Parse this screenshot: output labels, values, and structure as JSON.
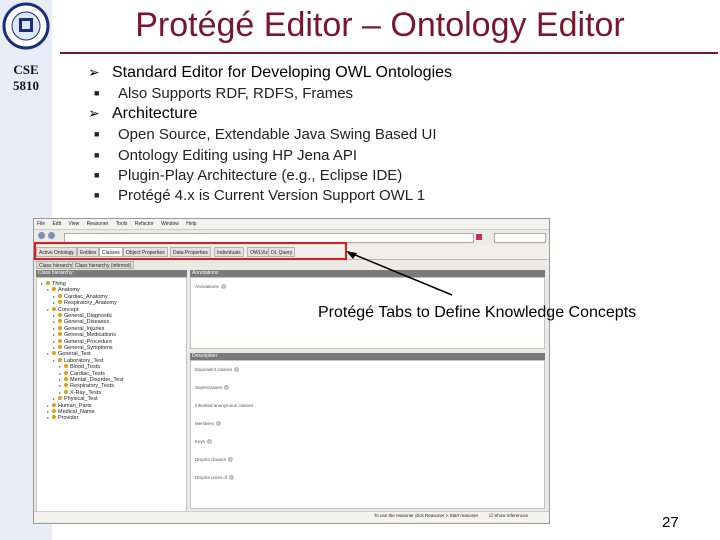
{
  "slide": {
    "title": "Protégé Editor – Ontology Editor",
    "course": "CSE\n5810",
    "page_number": "27",
    "callout": "Protégé Tabs to Define Knowledge Concepts",
    "colors": {
      "title": "#7a1530",
      "sidebar": "#e9edf8",
      "highlight_box": "#e41a1a"
    }
  },
  "bullets": [
    {
      "text": "Standard Editor for Developing OWL Ontologies",
      "sub": [
        "Also Supports RDF, RDFS, Frames"
      ]
    },
    {
      "text": "Architecture",
      "sub": [
        "Open Source, Extendable Java Swing Based UI",
        "Ontology Editing using HP Jena API",
        "Plugin-Play Architecture (e.g., Eclipse IDE)",
        "Protégé 4.x is Current Version Support OWL 1"
      ]
    }
  ],
  "app": {
    "menu": [
      "File",
      "Edit",
      "View",
      "Reasoner",
      "Tools",
      "Refactor",
      "Window",
      "Help"
    ],
    "tabs": [
      "Active Ontology",
      "Entities",
      "Classes",
      "Object Properties",
      "Data Properties",
      "Individuals",
      "OWLViz",
      "DL Query"
    ],
    "active_tab": "Classes",
    "subtabs": [
      "Class hierarchy",
      "Class hierarchy (inferred)"
    ],
    "left_header": "Class hierarchy:",
    "tree": [
      {
        "label": "Thing",
        "level": 0
      },
      {
        "label": "Anatomy",
        "level": 1
      },
      {
        "label": "Cardiac_Anatomy",
        "level": 2
      },
      {
        "label": "Respiratory_Anatomy",
        "level": 2
      },
      {
        "label": "Concept",
        "level": 1
      },
      {
        "label": "General_Diagnostic",
        "level": 2
      },
      {
        "label": "General_Diseases",
        "level": 2
      },
      {
        "label": "General_Injuries",
        "level": 2
      },
      {
        "label": "General_Medications",
        "level": 2
      },
      {
        "label": "General_Procedure",
        "level": 2
      },
      {
        "label": "General_Symptoms",
        "level": 2
      },
      {
        "label": "General_Test",
        "level": 1
      },
      {
        "label": "Laboratory_Test",
        "level": 2
      },
      {
        "label": "Blood_Tests",
        "level": 3
      },
      {
        "label": "Cardiac_Tests",
        "level": 3
      },
      {
        "label": "Mental_Disorder_Test",
        "level": 3
      },
      {
        "label": "Respiratory_Tests",
        "level": 3
      },
      {
        "label": "X-Ray_Tests",
        "level": 3
      },
      {
        "label": "Physical_Test",
        "level": 2
      },
      {
        "label": "Human_Parts",
        "level": 1
      },
      {
        "label": "Medical_Name",
        "level": 1
      },
      {
        "label": "Provider",
        "level": 1
      }
    ],
    "annotations_header": "Annotations",
    "annotations_row": "Annotations",
    "description_header": "Description",
    "description_rows": [
      "Equivalent classes",
      "Superclasses",
      "Inherited anonymous classes",
      "Members",
      "Keys",
      "Disjoint classes",
      "Disjoint union of"
    ],
    "status_message": "To use the reasoner click Reasoner > Start reasoner",
    "show_inferences": "Show Inferences"
  }
}
